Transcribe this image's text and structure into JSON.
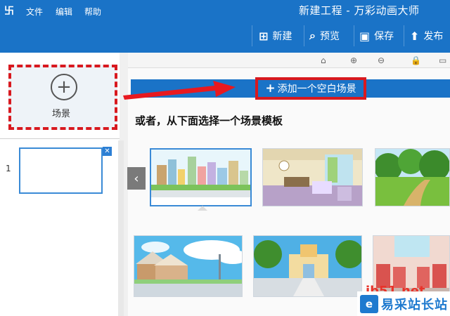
{
  "menu": {
    "logo": "卐",
    "items": [
      "文件",
      "编辑",
      "帮助"
    ]
  },
  "window": {
    "title": "新建工程 - 万彩动画大师"
  },
  "toolbar": {
    "new_label": "新建",
    "new_icon": "new-file-icon",
    "preview_label": "预览",
    "preview_icon": "preview-icon",
    "save_label": "保存",
    "save_icon": "save-icon",
    "publish_label": "发布",
    "publish_icon": "upload-icon"
  },
  "scene_panel": {
    "add_label": "场景",
    "add_icon": "plus-circle-icon",
    "slides": [
      {
        "number": "1"
      }
    ]
  },
  "main": {
    "add_blank_label": "添加一个空白场景",
    "choose_template_text": "或者，从下面选择一个场景模板",
    "strip_icons": [
      "home-icon",
      "zoom-in-icon",
      "zoom-out-icon",
      "lock-icon",
      "window-icon"
    ]
  },
  "templates": [
    {
      "name": "city-template",
      "selected": true
    },
    {
      "name": "room-template",
      "selected": false
    },
    {
      "name": "forest-template",
      "selected": false
    },
    {
      "name": "houses-template",
      "selected": false
    },
    {
      "name": "building-template",
      "selected": false
    },
    {
      "name": "interior-template",
      "selected": false
    }
  ],
  "watermark": {
    "logo": "e",
    "text": "易采站长站",
    "red_text": "jb51.net"
  },
  "colors": {
    "accent": "#1a73c7",
    "highlight": "#d8191f"
  }
}
